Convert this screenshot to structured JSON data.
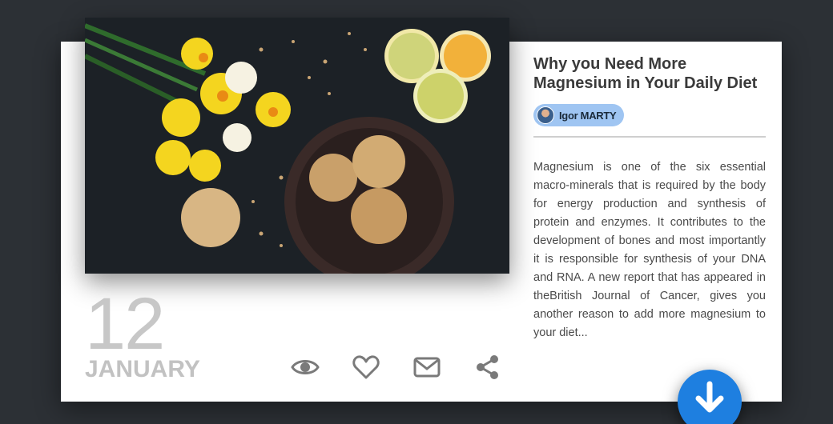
{
  "article": {
    "title": "Why you Need More Magnesium in Your Daily Diet",
    "author": "Igor MARTY",
    "excerpt": "Magnesium is one of the six essential macro-minerals that is required by the body for energy production and synthesis of protein and enzymes. It contributes to the development of bones and most importantly it is responsible for synthesis of your DNA and RNA. A new report that has appeared in theBritish Journal of Cancer, gives you another reason to add more magnesium to your diet..."
  },
  "date": {
    "day": "12",
    "month": "JANUARY"
  },
  "actions": {
    "icons": [
      "eye-icon",
      "heart-icon",
      "mail-icon",
      "share-icon"
    ]
  },
  "fab": {
    "icon": "arrow-down-icon",
    "color": "#1e7fe0"
  },
  "colors": {
    "background": "#2c3035",
    "card": "#ffffff",
    "author_badge": "#9fc5f2",
    "icon_gray": "#7a7a7a",
    "date_gray": "#c7c7c7"
  }
}
